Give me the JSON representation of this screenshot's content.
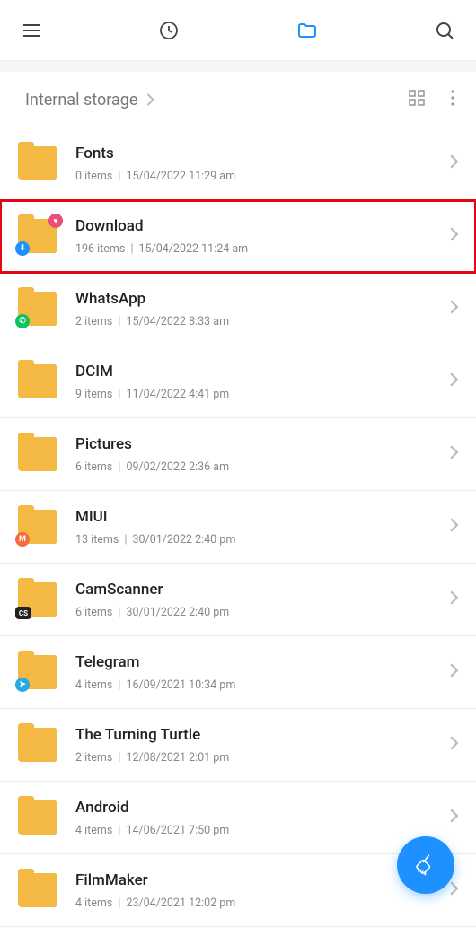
{
  "breadcrumb": {
    "label": "Internal storage"
  },
  "highlighted_index": 1,
  "folders": [
    {
      "name": "Fonts",
      "items": "0 items",
      "date": "15/04/2022 11:29 am",
      "badge": null
    },
    {
      "name": "Download",
      "items": "196 items",
      "date": "15/04/2022 11:24 am",
      "badge": "download"
    },
    {
      "name": "WhatsApp",
      "items": "2 items",
      "date": "15/04/2022 8:33 am",
      "badge": "whatsapp"
    },
    {
      "name": "DCIM",
      "items": "9 items",
      "date": "11/04/2022 4:41 pm",
      "badge": null
    },
    {
      "name": "Pictures",
      "items": "6 items",
      "date": "09/02/2022 2:36 am",
      "badge": null
    },
    {
      "name": "MIUI",
      "items": "13 items",
      "date": "30/01/2022 2:40 pm",
      "badge": "miui"
    },
    {
      "name": "CamScanner",
      "items": "6 items",
      "date": "30/01/2022 2:40 pm",
      "badge": "camscanner"
    },
    {
      "name": "Telegram",
      "items": "4 items",
      "date": "16/09/2021 10:34 pm",
      "badge": "telegram"
    },
    {
      "name": "The Turning Turtle",
      "items": "2 items",
      "date": "12/08/2021 2:01 pm",
      "badge": null
    },
    {
      "name": "Android",
      "items": "4 items",
      "date": "14/06/2021 7:50 pm",
      "badge": null
    },
    {
      "name": "FilmMaker",
      "items": "4 items",
      "date": "23/04/2021 12:02 pm",
      "badge": null
    }
  ]
}
